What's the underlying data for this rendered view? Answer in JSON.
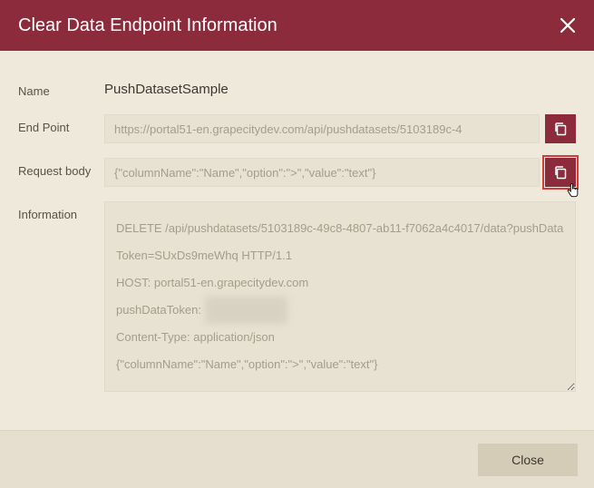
{
  "header": {
    "title": "Clear Data Endpoint Information"
  },
  "fields": {
    "name": {
      "label": "Name",
      "value": "PushDatasetSample"
    },
    "endpoint": {
      "label": "End Point",
      "value": "https://portal51-en.grapecitydev.com/api/pushdatasets/5103189c-4"
    },
    "requestBody": {
      "label": "Request body",
      "value": "{\"columnName\":\"Name\",\"option\":\">\",\"value\":\"text\"}"
    },
    "information": {
      "label": "Information",
      "lines": [
        "DELETE /api/pushdatasets/5103189c-49c8-4807-ab11-f7062a4c4017/data?pushDataToken=SUxDs9meWhq HTTP/1.1",
        "HOST: portal51-en.grapecitydev.com",
        "pushDataToken: ",
        "Content-Type: application/json",
        "{\"columnName\":\"Name\",\"option\":\">\",\"value\":\"text\"}"
      ],
      "redacted_token_placeholder": "xxxxxxxxxxxxxx"
    }
  },
  "footer": {
    "close_label": "Close"
  }
}
